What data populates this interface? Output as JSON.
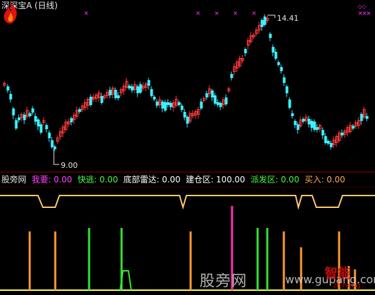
{
  "window": {
    "title": "深深宝A (日线)"
  },
  "price_panel": {
    "high_label": "14.41",
    "low_label": "9.00",
    "colors": {
      "up": "#ff3a3a",
      "down": "#3ef0ff",
      "marker": "#ff33ff",
      "axis": "#8b0000"
    }
  },
  "indicator_panel": {
    "name": "股旁网",
    "items": [
      {
        "label": "我要: 0.00",
        "color": "#ff44ff"
      },
      {
        "label": "快逃: 0.00",
        "color": "#44ff44"
      },
      {
        "label": "底部雷达: 0.00",
        "color": "#ffffff"
      },
      {
        "label": "建仓区: 100.00",
        "color": "#ffffff"
      },
      {
        "label": "派发区: 0.00",
        "color": "#44ff44"
      },
      {
        "label": "买入: 0.00",
        "color": "#ffaa55"
      }
    ],
    "colors": {
      "line": "#ffc872",
      "orange": "#ff9a30",
      "green": "#33e633",
      "magenta": "#ff33aa",
      "yellow": "#ffff40"
    }
  },
  "watermark": {
    "site_cn": "股旁网",
    "site_url": "www.gupang.com",
    "logo_cn": "智能",
    "logo_url": "zhineng"
  }
}
